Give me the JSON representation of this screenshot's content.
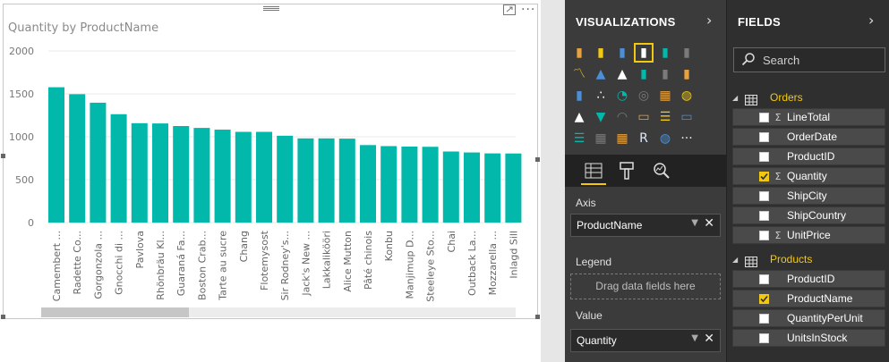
{
  "visual": {
    "title": "Quantity by ProductName",
    "focus_icon": "focus-mode-icon",
    "more_icon": "more-options-icon",
    "more_glyph": "···"
  },
  "chart_data": {
    "type": "bar",
    "title": "Quantity by ProductName",
    "xlabel": "",
    "ylabel": "",
    "ylim": [
      0,
      2000
    ],
    "yticks": [
      0,
      500,
      1000,
      1500,
      2000
    ],
    "grid": true,
    "color": "#01b8aa",
    "categories": [
      "Camembert ...",
      "Radette Co...",
      "Gorgonzola ...",
      "Gnocchi di ...",
      "Pavlova",
      "Rhönbräu Kl...",
      "Guaraná Fa...",
      "Boston Crab...",
      "Tarte au sucre",
      "Chang",
      "Flotemysost",
      "Sir Rodney's...",
      "Jack's New ...",
      "Lakkalikööri",
      "Alice Mutton",
      "Pâté chinois",
      "Konbu",
      "Manjimup D...",
      "Steeleye Sto...",
      "Chai",
      "Outback La...",
      "Mozzarella ...",
      "Inlagd Sill"
    ],
    "values": [
      1577,
      1496,
      1397,
      1263,
      1158,
      1155,
      1125,
      1103,
      1083,
      1057,
      1057,
      1012,
      981,
      981,
      978,
      903,
      891,
      886,
      883,
      828,
      817,
      806,
      805
    ]
  },
  "visualizations": {
    "header": "VISUALIZATIONS",
    "chevron": "›",
    "tiles": [
      [
        "stacked-bar-icon",
        "stacked-column-icon",
        "clustered-bar-icon",
        "clustered-column-icon",
        "100-stacked-bar-icon",
        "100-stacked-column-icon"
      ],
      [
        "line-chart-icon",
        "area-chart-icon",
        "stacked-area-icon",
        "line-column-icon",
        "line-clustered-column-icon",
        "ribbon-chart-icon"
      ],
      [
        "waterfall-icon",
        "scatter-icon",
        "pie-icon",
        "donut-icon",
        "treemap-icon",
        "map-icon"
      ],
      [
        "filled-map-icon",
        "funnel-icon",
        "gauge-icon",
        "card-icon",
        "multi-row-card-icon",
        "kpi-icon"
      ],
      [
        "slicer-icon",
        "table-icon",
        "matrix-icon",
        "r-visual-icon",
        "globe-icon",
        "more-visuals-icon"
      ]
    ],
    "tabs": [
      "fields-tab-icon",
      "format-tab-icon",
      "analytics-tab-icon"
    ],
    "wells": {
      "axis_label": "Axis",
      "axis_value": "ProductName",
      "legend_label": "Legend",
      "legend_placeholder": "Drag data fields here",
      "value_label": "Value",
      "value_value": "Quantity"
    }
  },
  "fields": {
    "header": "FIELDS",
    "chevron": "›",
    "search_placeholder": "Search",
    "tables": [
      {
        "name": "Orders",
        "fields": [
          {
            "name": "LineTotal",
            "sigma": true,
            "checked": false
          },
          {
            "name": "OrderDate",
            "sigma": false,
            "checked": false
          },
          {
            "name": "ProductID",
            "sigma": false,
            "checked": false
          },
          {
            "name": "Quantity",
            "sigma": true,
            "checked": true
          },
          {
            "name": "ShipCity",
            "sigma": false,
            "checked": false
          },
          {
            "name": "ShipCountry",
            "sigma": false,
            "checked": false
          },
          {
            "name": "UnitPrice",
            "sigma": true,
            "checked": false
          }
        ]
      },
      {
        "name": "Products",
        "fields": [
          {
            "name": "ProductID",
            "sigma": false,
            "checked": false
          },
          {
            "name": "ProductName",
            "sigma": false,
            "checked": true
          },
          {
            "name": "QuantityPerUnit",
            "sigma": false,
            "checked": false
          },
          {
            "name": "UnitsInStock",
            "sigma": false,
            "checked": false
          }
        ]
      }
    ]
  },
  "colors": {
    "accent": "#f2c811",
    "bar": "#01b8aa",
    "panel": "#3b3b3b"
  }
}
